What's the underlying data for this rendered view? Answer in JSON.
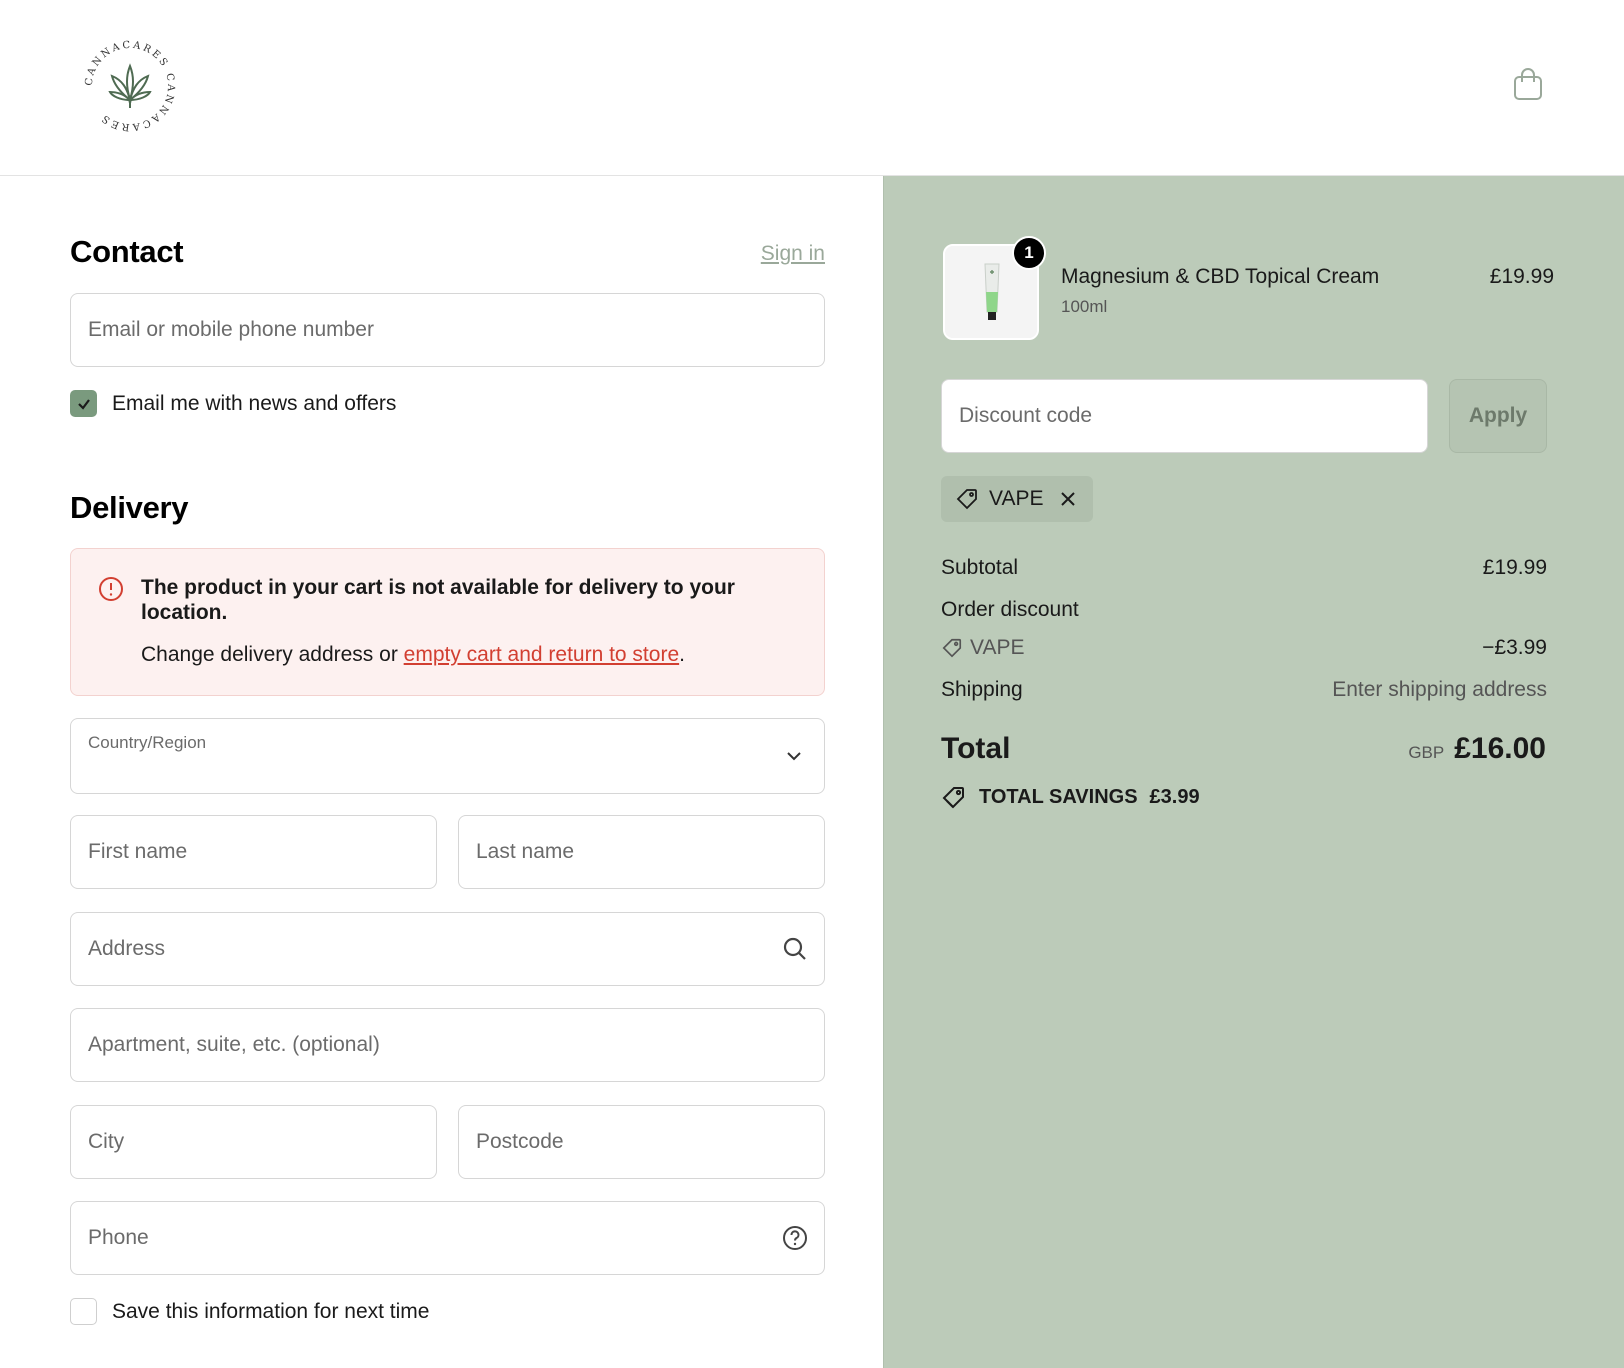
{
  "brand": {
    "logo_text": "CANNACARES CANNACARES"
  },
  "contact": {
    "title": "Contact",
    "sign_in": "Sign in",
    "email_placeholder": "Email or mobile phone number",
    "news_label": "Email me with news and offers",
    "news_checked": true
  },
  "delivery": {
    "title": "Delivery",
    "alert_title": "The product in your cart is not available for delivery to your location.",
    "alert_body_prefix": "Change delivery address or ",
    "alert_link": "empty cart and return to store",
    "alert_body_suffix": ".",
    "country_label": "Country/Region",
    "first_name": "First name",
    "last_name": "Last name",
    "address": "Address",
    "apartment": "Apartment, suite, etc. (optional)",
    "city": "City",
    "postcode": "Postcode",
    "phone": "Phone",
    "save_label": "Save this information for next time",
    "save_checked": false
  },
  "summary": {
    "product": {
      "qty": "1",
      "name": "Magnesium & CBD Topical Cream",
      "variant": "100ml",
      "price": "£19.99"
    },
    "discount_placeholder": "Discount code",
    "apply_label": "Apply",
    "applied_code": "VAPE",
    "subtotal_label": "Subtotal",
    "subtotal_value": "£19.99",
    "order_discount_label": "Order discount",
    "discount_code": "VAPE",
    "discount_value": "−£3.99",
    "shipping_label": "Shipping",
    "shipping_value": "Enter shipping address",
    "total_label": "Total",
    "total_currency": "GBP",
    "total_value": "£16.00",
    "savings_label": "TOTAL SAVINGS",
    "savings_value": "£3.99"
  },
  "colors": {
    "accent": "#7a9a7e",
    "summary_bg": "#bccbb9",
    "alert_bg": "#fdf1f0",
    "error": "#d23f31"
  }
}
